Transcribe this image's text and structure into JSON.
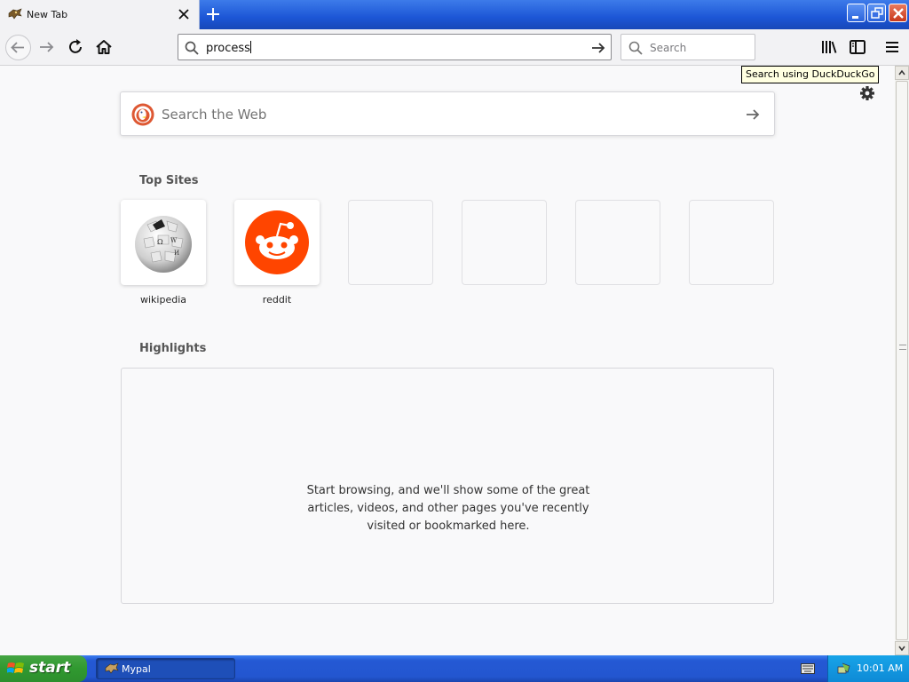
{
  "browser": {
    "tab": {
      "title": "New Tab"
    },
    "url_bar": {
      "value": "process"
    },
    "search_bar": {
      "placeholder": "Search"
    },
    "tooltip": "Search using DuckDuckGo"
  },
  "newtab": {
    "web_search": {
      "placeholder": "Search the Web"
    },
    "top_sites": {
      "title": "Top Sites",
      "sites": [
        {
          "label": "wikipedia",
          "icon": "wikipedia-globe-icon"
        },
        {
          "label": "reddit",
          "icon": "reddit-alien-icon"
        },
        {
          "label": ""
        },
        {
          "label": ""
        },
        {
          "label": ""
        },
        {
          "label": ""
        }
      ]
    },
    "highlights": {
      "title": "Highlights",
      "message": "Start browsing, and we'll show some of the great articles, videos, and other pages you've recently visited or bookmarked here."
    }
  },
  "taskbar": {
    "start_label": "start",
    "task_item": "Mypal",
    "clock": "10:01 AM"
  },
  "colors": {
    "reddit_orange": "#ff4500",
    "xp_blue": "#2459d4",
    "start_green": "#309930"
  }
}
